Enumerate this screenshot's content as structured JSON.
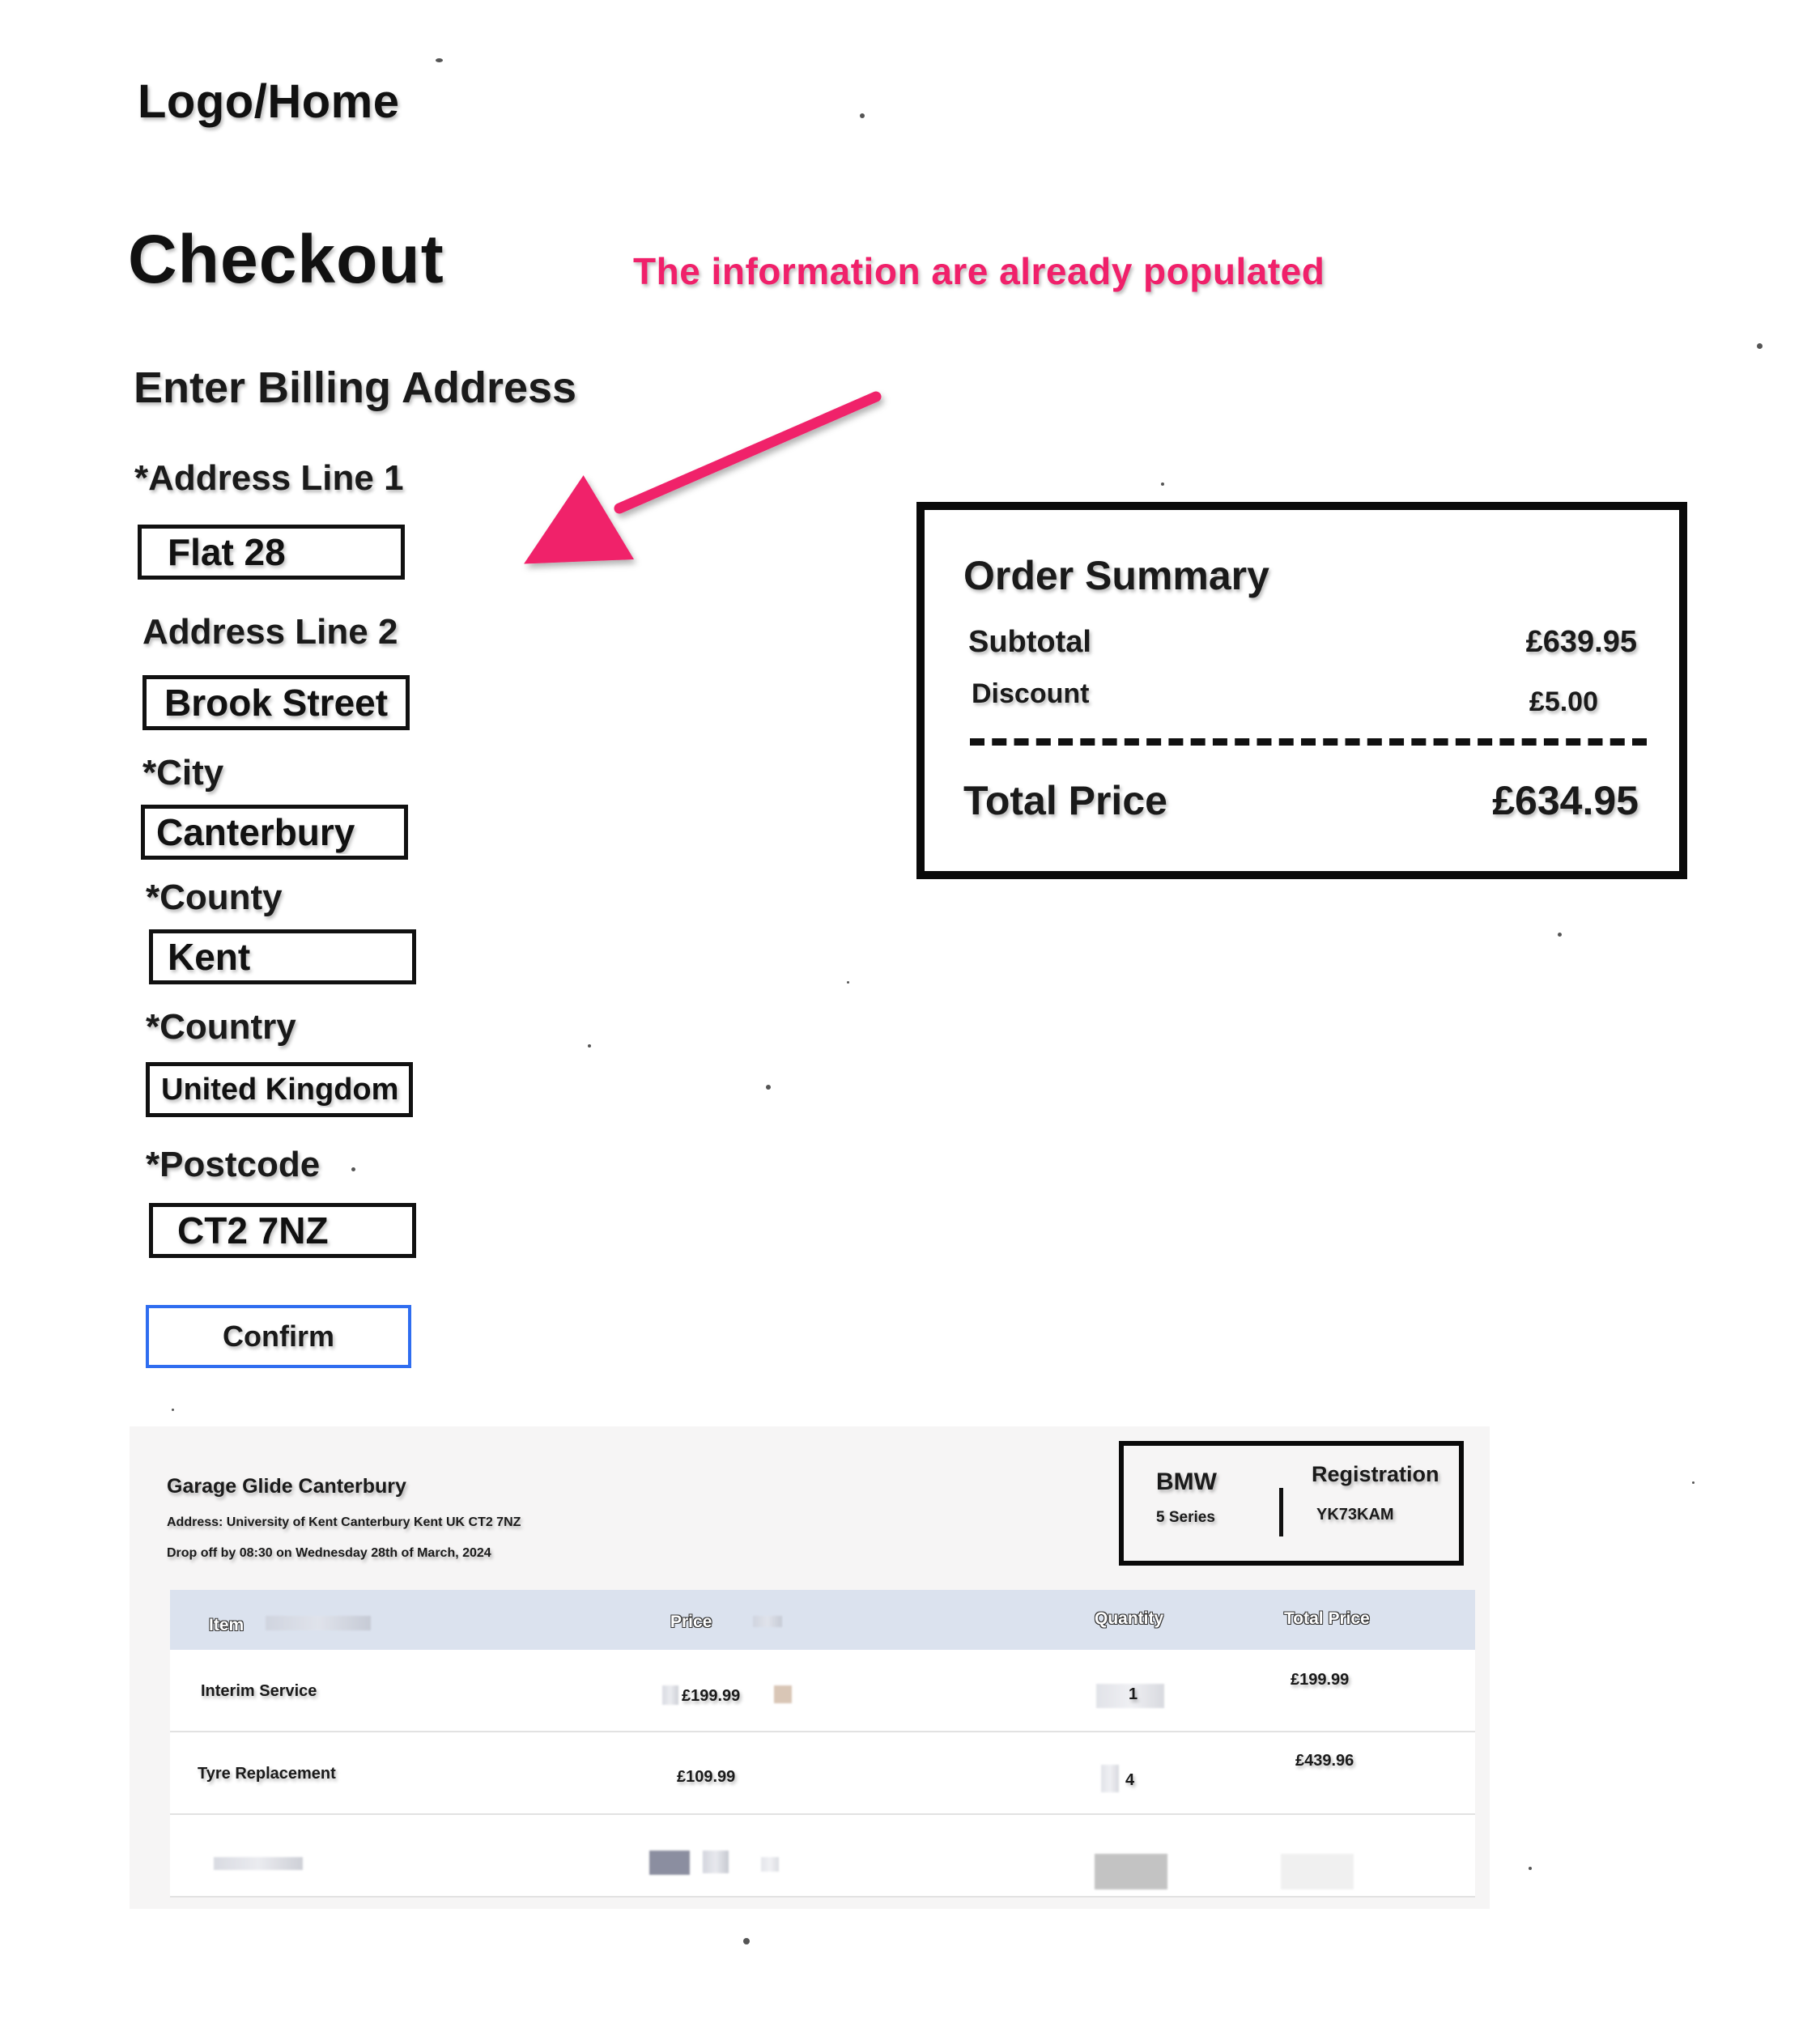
{
  "header": {
    "logo_label": "Logo/Home",
    "page_title": "Checkout",
    "annotation_note": "The information are already populated",
    "note_color": "#f0206a"
  },
  "billing": {
    "heading": "Enter Billing Address",
    "fields": {
      "address_line_1": {
        "label": "*Address Line 1",
        "value": "Flat 28"
      },
      "address_line_2": {
        "label": "Address Line 2",
        "value": "Brook Street"
      },
      "city": {
        "label": "*City",
        "value": "Canterbury"
      },
      "county": {
        "label": "*County",
        "value": "Kent"
      },
      "country": {
        "label": "*Country",
        "value": "United Kingdom"
      },
      "postcode": {
        "label": "*Postcode",
        "value": "CT2 7NZ"
      }
    },
    "confirm_label": "Confirm",
    "confirm_border_color": "#2f6df0"
  },
  "order_summary": {
    "title": "Order Summary",
    "subtotal_label": "Subtotal",
    "subtotal_value": "£639.95",
    "discount_label": "Discount",
    "discount_value": "£5.00",
    "total_label": "Total Price",
    "total_value": "£634.95"
  },
  "booking": {
    "garage_name": "Garage Glide Canterbury",
    "address": "Address: University of Kent Canterbury Kent UK CT2 7NZ",
    "dropoff": "Drop off by 08:30 on Wednesday 28th of March, 2024",
    "vehicle": {
      "make": "BMW",
      "model": "5 Series",
      "registration_label": "Registration",
      "registration_value": "YK73KAM"
    },
    "table": {
      "headers": [
        "Item",
        "Price",
        "Quantity",
        "Total Price"
      ],
      "header_bg": "#dbe2ee",
      "rows": [
        {
          "item": "Interim Service",
          "price": "£199.99",
          "quantity": "1",
          "total": "£199.99"
        },
        {
          "item": "Tyre Replacement",
          "price": "£109.99",
          "quantity": "4",
          "total": "£439.96"
        }
      ]
    }
  }
}
